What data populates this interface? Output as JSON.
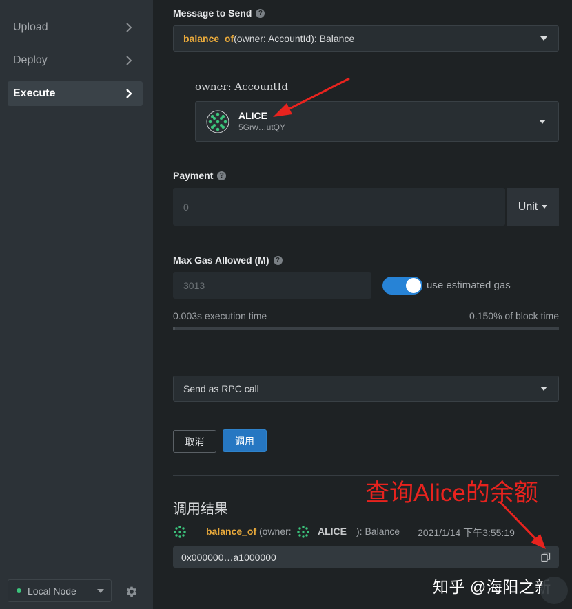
{
  "sidebar": {
    "items": [
      {
        "label": "Upload",
        "active": false
      },
      {
        "label": "Deploy",
        "active": false
      },
      {
        "label": "Execute",
        "active": true
      }
    ],
    "node_selector": {
      "label": "Local Node",
      "status_color": "#3cc47c"
    }
  },
  "message": {
    "label": "Message to Send",
    "selected_fn": "balance_of",
    "selected_sig": "(owner: AccountId): Balance"
  },
  "param": {
    "label": "owner: AccountId",
    "account_name": "ALICE",
    "account_address": "5Grw…utQY"
  },
  "payment": {
    "label": "Payment",
    "placeholder": "0",
    "unit_label": "Unit"
  },
  "gas": {
    "label": "Max Gas Allowed (M)",
    "placeholder": "3013",
    "toggle_label": "use estimated gas",
    "toggle_on": true,
    "execution_time": "0.003s execution time",
    "block_time": "0.150% of block time",
    "block_time_percent": 0.15
  },
  "send_mode": {
    "label": "Send as RPC call"
  },
  "buttons": {
    "cancel": "取消",
    "call": "调用"
  },
  "results": {
    "title": "调用结果",
    "fn": "balance_of",
    "sig_open": "(owner: ",
    "account": "ALICE",
    "sig_close": "): Balance",
    "timestamp": "2021/1/14 下午3:55:19",
    "output": "0x000000…a1000000"
  },
  "annotation": {
    "text": "查询Alice的余额",
    "color": "#e8231e"
  },
  "watermark": {
    "text": "知乎 @海阳之新"
  },
  "colors": {
    "accent": "#2677c2",
    "fn_highlight": "#e8a93b",
    "identicon": "#3cc47c"
  }
}
